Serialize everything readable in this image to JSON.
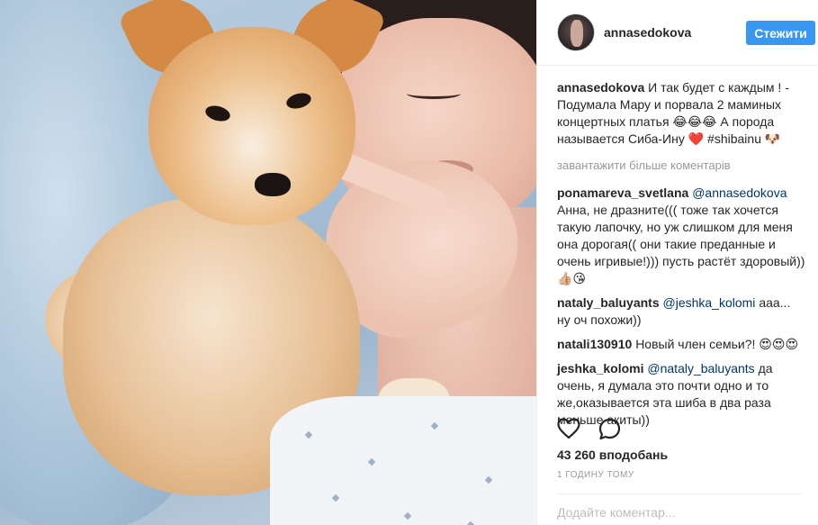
{
  "post": {
    "username": "annasedokova",
    "follow_label": "Стежити",
    "caption": {
      "user": "annasedokova",
      "text": "И так будет с каждым ! - Подумала Мару и порвала 2 маминых концертных платья 😂😂😂 А порода называется Сиба-Ину ❤️ #shibainu 🐶"
    },
    "load_more_label": "завантажити більше коментарів",
    "comments": [
      {
        "user": "ponamareva_svetlana",
        "mention": "@annasedokova",
        "text": "Анна, не дразните((( тоже так хочется такую лапочку, но уж слишком для меня она дорогая(( они такие преданные и очень игривые!))) пусть растёт здоровый)) 👍🏼😘"
      },
      {
        "user": "nataly_baluyants",
        "mention": "@jeshka_kolomi",
        "text": "ааа... ну оч похожи))"
      },
      {
        "user": "natali130910",
        "mention": "",
        "text": "Новый член семьи?! 😍😍😍"
      },
      {
        "user": "jeshka_kolomi",
        "mention": "@nataly_baluyants",
        "text": "да очень, я думала это почти одно и то же,оказывается эта шиба в два раза меньше акиты))"
      }
    ],
    "likes_label": "43 260 вподобань",
    "time_label": "1 ГОДИНУ ТОМУ",
    "comment_placeholder": "Додайте коментар..."
  },
  "icons": {
    "like": "heart-icon",
    "comment": "comment-bubble-icon"
  },
  "colors": {
    "follow_button": "#3897f0",
    "text": "#262626",
    "muted": "#999999",
    "mention": "#003569"
  }
}
